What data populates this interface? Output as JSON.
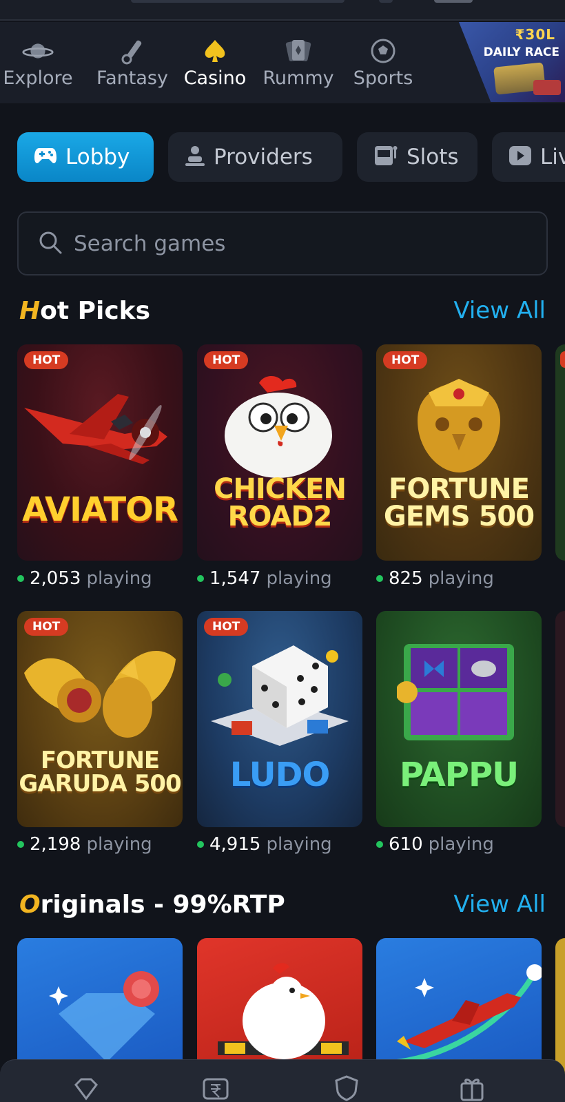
{
  "categories": [
    {
      "label": "Explore",
      "icon": "planet-icon"
    },
    {
      "label": "Fantasy",
      "icon": "cricket-icon"
    },
    {
      "label": "Casino",
      "icon": "spade-icon"
    },
    {
      "label": "Rummy",
      "icon": "cards-icon"
    },
    {
      "label": "Sports",
      "icon": "football-icon"
    }
  ],
  "promo": {
    "amount": "₹30L",
    "title": "DAILY RACE"
  },
  "tabs": [
    {
      "label": "Lobby",
      "icon": "gamepad-icon"
    },
    {
      "label": "Providers",
      "icon": "user-icon"
    },
    {
      "label": "Slots",
      "icon": "slot-machine-icon"
    },
    {
      "label": "Live",
      "icon": "play-icon"
    }
  ],
  "search": {
    "placeholder": "Search games"
  },
  "hot_picks": {
    "title_first": "H",
    "title_rest": "ot Picks",
    "view_all": "View All",
    "playing_label": "playing",
    "badge": "HOT",
    "games": [
      {
        "name": "AVIATOR",
        "players": "2,053"
      },
      {
        "name": "CHICKEN\nROAD2",
        "players": "1,547"
      },
      {
        "name": "FORTUNE\nGEMS 500",
        "players": "825"
      },
      {
        "name": "FORTUNE\nGARUDA 500",
        "players": "2,198"
      },
      {
        "name": "LUDO",
        "players": "4,915"
      },
      {
        "name": "PAPPU",
        "players": "610"
      }
    ]
  },
  "originals": {
    "title_first": "O",
    "title_rest": "riginals - 99%RTP",
    "view_all": "View All"
  },
  "colors": {
    "accent": "#22b0ef",
    "hot": "#d63b22",
    "gold": "#f2b521",
    "online": "#23c55e"
  }
}
